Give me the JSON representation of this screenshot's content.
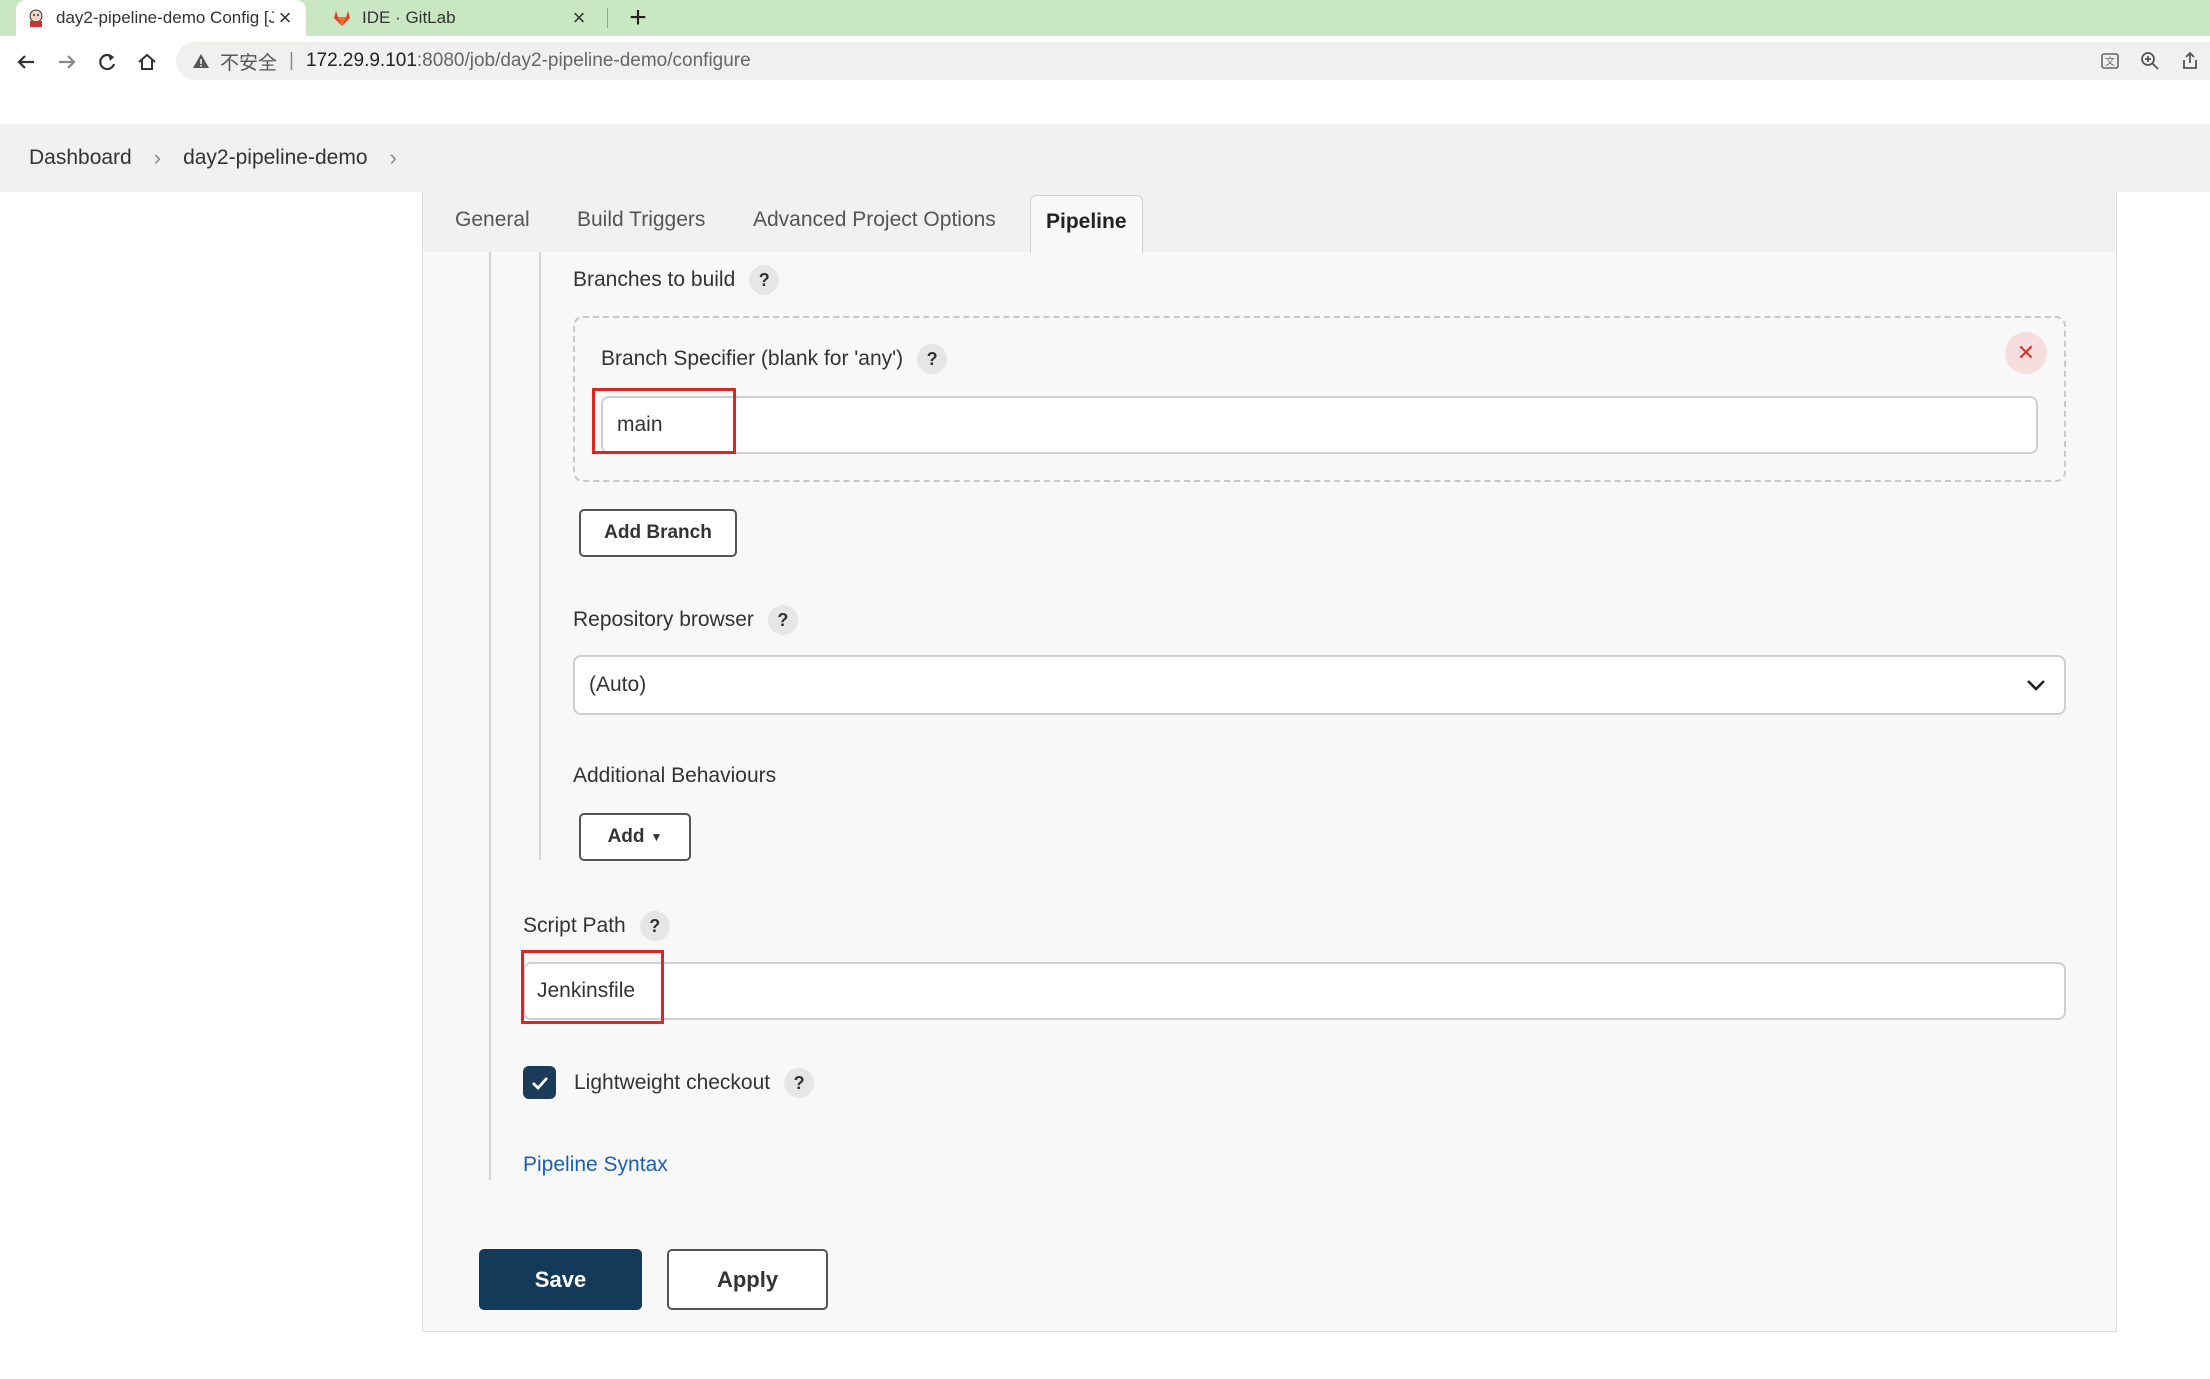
{
  "browser": {
    "tabs": [
      {
        "title": "day2-pipeline-demo Config [J",
        "active": true,
        "icon": "jenkins-icon"
      },
      {
        "title": "IDE · GitLab",
        "active": false,
        "icon": "gitlab-icon"
      }
    ],
    "address": {
      "security_label": "不安全",
      "host": "172.29.9.101",
      "path": ":8080/job/day2-pipeline-demo/configure"
    }
  },
  "breadcrumb": {
    "items": [
      "Dashboard",
      "day2-pipeline-demo"
    ]
  },
  "config_tabs": [
    "General",
    "Build Triggers",
    "Advanced Project Options",
    "Pipeline"
  ],
  "active_tab": "Pipeline",
  "form": {
    "branches_label": "Branches to build",
    "branch_specifier_label": "Branch Specifier (blank for 'any')",
    "branch_specifier_value": "main",
    "add_branch_label": "Add Branch",
    "repo_browser_label": "Repository browser",
    "repo_browser_value": "(Auto)",
    "additional_behaviours_label": "Additional Behaviours",
    "add_label": "Add",
    "script_path_label": "Script Path",
    "script_path_value": "Jenkinsfile",
    "lightweight_checkout_label": "Lightweight checkout",
    "lightweight_checkout_checked": true,
    "pipeline_syntax_link": "Pipeline Syntax"
  },
  "actions": {
    "save_label": "Save",
    "apply_label": "Apply"
  },
  "colors": {
    "tabstrip": "#c9e7c3",
    "primary_button": "#143a5a",
    "highlight_box": "#e02424",
    "link": "#1a5fb4"
  }
}
